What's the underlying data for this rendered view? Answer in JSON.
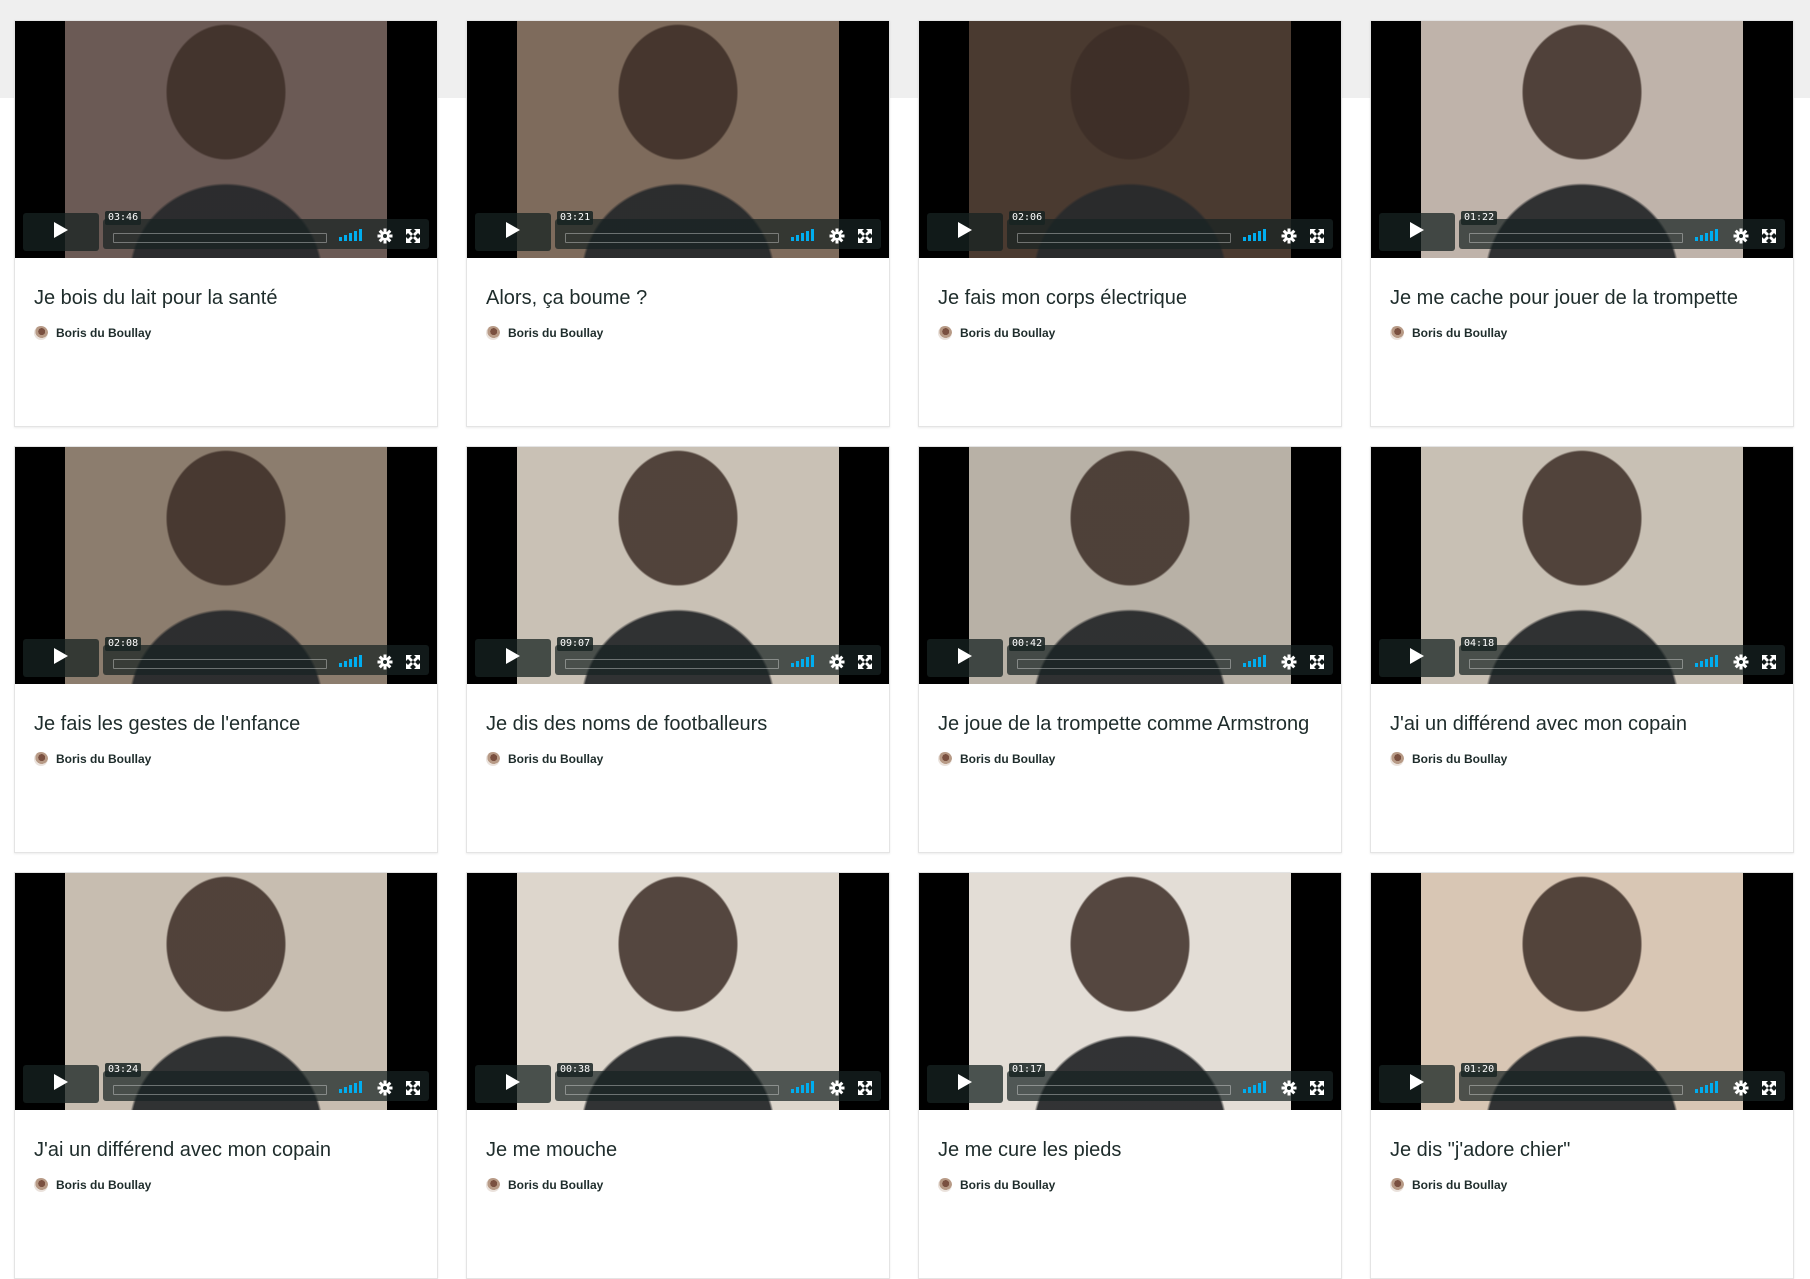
{
  "videos": [
    {
      "title": "Je bois du lait pour la santé",
      "author": "Boris du Boullay",
      "duration": "03:46"
    },
    {
      "title": "Alors, ça boume ?",
      "author": "Boris du Boullay",
      "duration": "03:21"
    },
    {
      "title": "Je fais mon corps électrique",
      "author": "Boris du Boullay",
      "duration": "02:06"
    },
    {
      "title": "Je me cache pour jouer de la trompette",
      "author": "Boris du Boullay",
      "duration": "01:22"
    },
    {
      "title": "Je fais les gestes de l'enfance",
      "author": "Boris du Boullay",
      "duration": "02:08"
    },
    {
      "title": "Je dis des noms de footballeurs",
      "author": "Boris du Boullay",
      "duration": "09:07"
    },
    {
      "title": "Je joue de la trompette comme Armstrong",
      "author": "Boris du Boullay",
      "duration": "00:42"
    },
    {
      "title": "J'ai un différend avec mon copain",
      "author": "Boris du Boullay",
      "duration": "04:18"
    },
    {
      "title": "J'ai un différend avec mon copain",
      "author": "Boris du Boullay",
      "duration": "03:24"
    },
    {
      "title": "Je me mouche",
      "author": "Boris du Boullay",
      "duration": "00:38"
    },
    {
      "title": "Je me cure les pieds",
      "author": "Boris du Boullay",
      "duration": "01:17"
    },
    {
      "title": "Je dis \"j'adore chier\"",
      "author": "Boris du Boullay",
      "duration": "01:20"
    }
  ],
  "frame_colors": [
    "#6b5a55",
    "#7e6b5c",
    "#4a3a30",
    "#bfb3aa",
    "#8c7d6e",
    "#c9c1b5",
    "#b8b1a6",
    "#c8c0b4",
    "#c7bdb0",
    "#ddd6cc",
    "#e3ddd6",
    "#d8c6b4"
  ],
  "accent_color": "#00adef"
}
